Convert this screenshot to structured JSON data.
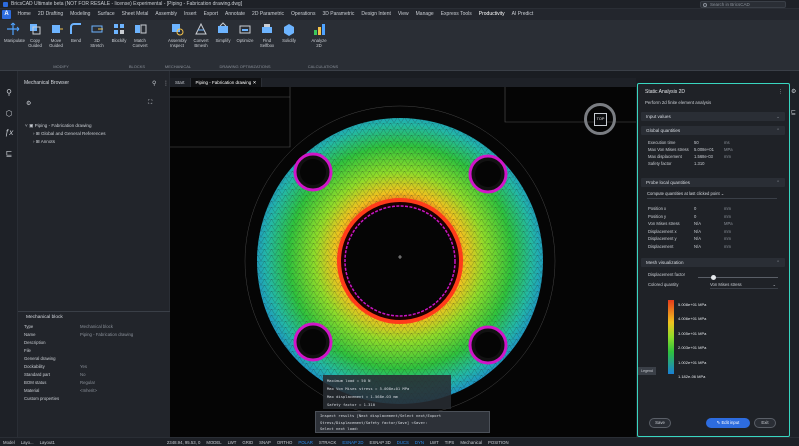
{
  "window": {
    "title": "BricsCAD Ultimate beta (NOT FOR RESALE - license) Experimental - [Piping - Fabrication drawing.dwg]",
    "search_placeholder": "Search in BricsCAD",
    "workspace": "Modelspace"
  },
  "menu_tabs": [
    "Home",
    "2D Drafting",
    "Modeling",
    "Surface",
    "Sheet Metal",
    "Assembly",
    "Insert",
    "Export",
    "Annotate",
    "2D Parametric",
    "Operations",
    "3D Parametric",
    "Design Intent",
    "View",
    "Manage",
    "Express Tools",
    "Productivity",
    "AI Predict"
  ],
  "ribbon": {
    "buttons": [
      {
        "label": "Manipulate",
        "icon": "manipulate-icon"
      },
      {
        "label": "Copy\nGuided",
        "icon": "copy-guided-icon"
      },
      {
        "label": "Move\nGuided",
        "icon": "move-guided-icon"
      },
      {
        "label": "Bend",
        "icon": "bend-icon"
      },
      {
        "label": "3D\nStretch",
        "icon": "stretch-icon"
      },
      {
        "label": "Blockify",
        "icon": "blockify-icon"
      },
      {
        "label": "Match\nConvert",
        "icon": "match-convert-icon"
      },
      {
        "label": "Assembly\nInspect",
        "icon": "assembly-inspect-icon"
      },
      {
        "label": "Convert\nBmesh",
        "icon": "convert-bmesh-icon"
      },
      {
        "label": "Simplify",
        "icon": "simplify-icon"
      },
      {
        "label": "Optimize",
        "icon": "optimize-icon"
      },
      {
        "label": "Find\nSelfbox",
        "icon": "find-icon"
      },
      {
        "label": "Solidify",
        "icon": "solidify-icon"
      },
      {
        "label": "Analyze\n2D",
        "icon": "analyze-icon"
      }
    ],
    "groups": [
      "MODIFY",
      "BLOCKS",
      "MECHANICAL",
      "DRAWING OPTIMIZATIONS",
      "CALCULATIONS"
    ]
  },
  "browser": {
    "title": "Mechanical Browser",
    "tree": [
      "Piping - Fabrication drawing",
      "Global and General References",
      "Annots"
    ]
  },
  "properties": {
    "title": "Mechanical block",
    "rows": [
      {
        "key": "Type",
        "value": "Mechanical block"
      },
      {
        "key": "Name",
        "value": "Piping - Fabrication drawing"
      },
      {
        "key": "Description",
        "value": ""
      },
      {
        "key": "File",
        "value": ""
      },
      {
        "key": "General drawing",
        "value": ""
      },
      {
        "key": "Dockability",
        "value": "Yes"
      },
      {
        "key": "Standard part",
        "value": "No"
      },
      {
        "key": "BOM status",
        "value": "Regular"
      },
      {
        "key": "Material",
        "value": "<Inherit>"
      },
      {
        "key": "Custom properties",
        "value": ""
      }
    ]
  },
  "doc_tabs": [
    "Start",
    "Piping - Fabrication drawing"
  ],
  "viewcube_label": "TOP",
  "command_history": [
    "Maximum load = 50 N",
    "Max Von Mises stress = 5.008e+01 MPa",
    "Max displacement = 1.568e-03 mm",
    "Safety factor = 1.310"
  ],
  "command_prompt": {
    "line1": "Inspect results [Next displacement/Select next/Export",
    "line2": "Stress/Displacement/Safety factor/Save] <Save>:",
    "line3": "Select next load:"
  },
  "analysis": {
    "title": "Static Analysis 2D",
    "subtitle": "Perform 2d finite element analysis",
    "sections": {
      "input": "Input values",
      "global": "Global quantities",
      "probe": "Probe local quantities",
      "mode": "Mesh visualization"
    },
    "global_rows": [
      {
        "k": "Execution time",
        "v": "50",
        "u": "ms"
      },
      {
        "k": "Max Von Mises stress",
        "v": "5.008e+01",
        "u": "MPa"
      },
      {
        "k": "Max displacement",
        "v": "1.568e-03",
        "u": "mm"
      },
      {
        "k": "Safety factor",
        "v": "1.310",
        "u": ""
      }
    ],
    "probe_select": "Compute quantities at last clicked point",
    "probe_rows": [
      {
        "k": "Position x",
        "v": "0",
        "u": "mm"
      },
      {
        "k": "Position y",
        "v": "0",
        "u": "mm"
      },
      {
        "k": "Von Mises stress",
        "v": "N/A",
        "u": "MPa"
      },
      {
        "k": "Displacement x",
        "v": "N/A",
        "u": "mm"
      },
      {
        "k": "Displacement y",
        "v": "N/A",
        "u": "mm"
      },
      {
        "k": "Displacement",
        "v": "N/A",
        "u": "mm"
      }
    ],
    "displacement_label": "Displacement factor",
    "colored_by_label": "Colored quantity",
    "colored_by_value": "Von Mises stress",
    "legend_labels": [
      "5.008e+01 MPa",
      "4.006e+01 MPa",
      "3.005e+01 MPa",
      "2.003e+01 MPa",
      "1.002e+01 MPa",
      "1.182e-06 MPa"
    ],
    "legend_side_label": "Legend",
    "buttons": {
      "save": "Save",
      "edit": "Edit input",
      "exit": "Exit"
    }
  },
  "status": {
    "items": [
      "Model",
      "Layo...",
      "Layout1"
    ],
    "coords": "2348.94, 95.53, 0",
    "toggles": [
      "MODEL",
      "LWT",
      "GRID",
      "SNAP",
      "ORTHO",
      "POLAR",
      "STRACK",
      "ESNAP 2D",
      "ESNAP 3D",
      "DUCS",
      "DYN",
      "LWT",
      "TIPS",
      "Mechanical",
      "POSITION"
    ]
  },
  "colors": {
    "accent": "#2d8cf0",
    "panel_border": "#39d6c0",
    "hole_ring": "#d015c8"
  }
}
